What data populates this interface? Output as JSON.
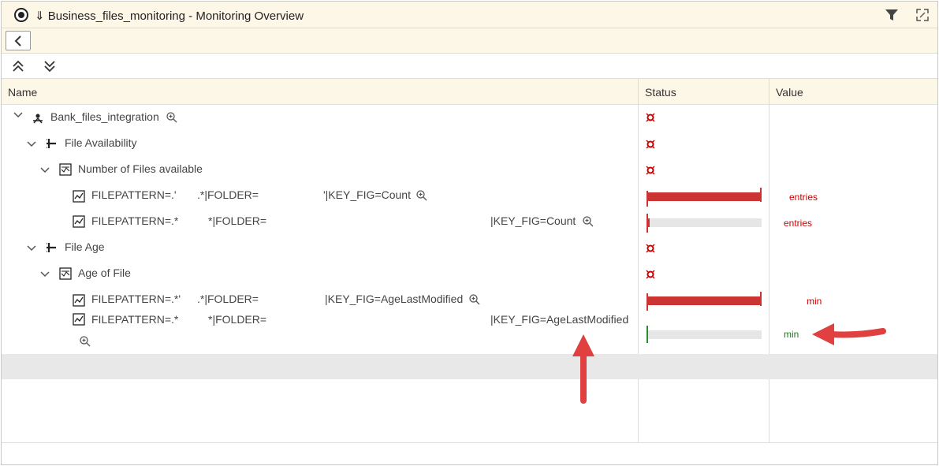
{
  "window": {
    "title": "⇓ Business_files_monitoring - Monitoring Overview",
    "icons": [
      "app-logo-icon",
      "filter-icon",
      "fullscreen-icon"
    ]
  },
  "nav": {
    "back_icon": "chevron-left-icon"
  },
  "toolbar": {
    "collapse_all_icon": "double-chevron-up-icon",
    "expand_all_icon": "double-chevron-down-icon"
  },
  "table": {
    "columns": [
      "Name",
      "Status",
      "Value"
    ],
    "rows": [
      {
        "label": "Bank_files_integration",
        "has_zoom": true,
        "status": "alert"
      },
      {
        "label": "File Availability",
        "status": "alert"
      },
      {
        "label": "Number of Files available",
        "status": "alert"
      },
      {
        "label_part1": "FILEPATTERN=.'",
        "label_part2": ".*|FOLDER=",
        "label_part3": "'|KEY_FIG=Count",
        "has_zoom": true,
        "bar_fill": 1.0,
        "bar_color": "#cc3333",
        "value_text": "entries",
        "value_color": "#cc0000"
      },
      {
        "label_part1": "FILEPATTERN=.*",
        "label_part2": "*|FOLDER=",
        "label_part3": "|KEY_FIG=Count",
        "has_zoom": true,
        "bar_fill": 0.03,
        "bar_color": "#cc3333",
        "value_text": "entries",
        "value_color": "#cc0000"
      },
      {
        "label": "File Age",
        "status": "alert"
      },
      {
        "label": "Age of File",
        "status": "alert"
      },
      {
        "label_part1": "FILEPATTERN=.*'",
        "label_part2": ".*|FOLDER=",
        "label_part3": "|KEY_FIG=AgeLastModified",
        "has_zoom": true,
        "bar_fill": 1.0,
        "bar_color": "#cc3333",
        "value_text": "min",
        "value_color": "#cc0000"
      },
      {
        "label_part1": "FILEPATTERN=.*",
        "label_part2": "*|FOLDER=",
        "label_part3": "|KEY_FIG=AgeLastModified",
        "has_zoom": true,
        "bar_fill": 0.01,
        "bar_color": "#2e8b2e",
        "value_text": "min",
        "value_color": "#1e7a1e"
      }
    ]
  },
  "colors": {
    "alert": "#cc0000",
    "header_bg": "#fdf7e8",
    "arrow": "#e04040"
  }
}
